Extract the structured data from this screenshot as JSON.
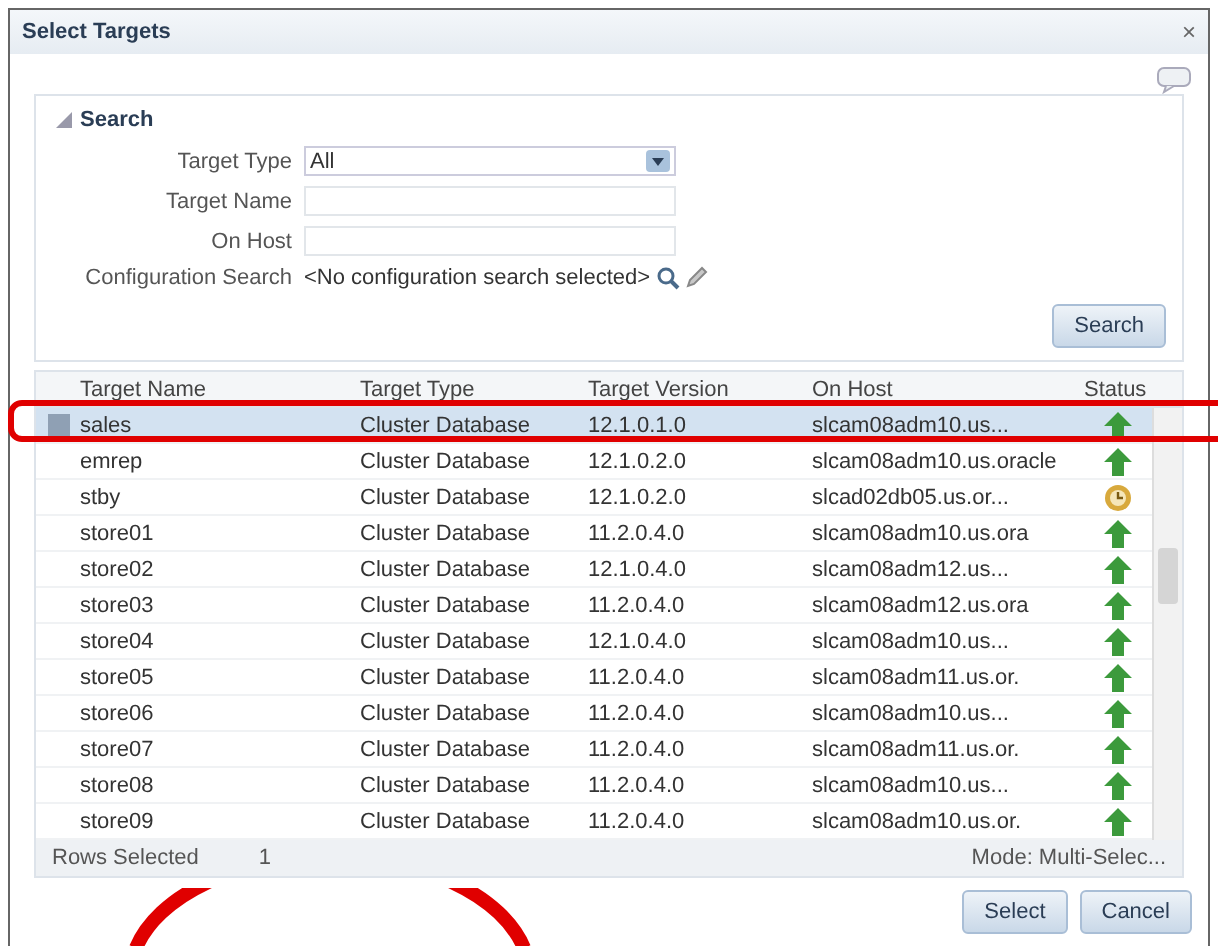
{
  "dialog": {
    "title": "Select Targets",
    "close": "×"
  },
  "search": {
    "title": "Search",
    "expanded": true,
    "fields": [
      {
        "kind": "select",
        "label": "Target Type",
        "value": "All"
      },
      {
        "kind": "text",
        "label": "Target Name"
      },
      {
        "kind": "text",
        "label": "On Host"
      },
      {
        "kind": "config",
        "label": "Configuration Search",
        "value": "<No configuration search selected>"
      }
    ],
    "button": "Search"
  },
  "table": {
    "columns": [
      "Target Name",
      "Target Type",
      "Target Version",
      "On Host",
      "Status"
    ],
    "rows": [
      {
        "name": "sales",
        "type": "Cluster Database",
        "version": "12.1.0.1.0",
        "host": "slcam08adm10.us...",
        "kind": "up",
        "selected": true
      },
      {
        "name": "emrep",
        "type": "Cluster Database",
        "version": "12.1.0.2.0",
        "host": "slcam08adm10.us.oracle",
        "kind": "up",
        "selected": false
      },
      {
        "name": "stby",
        "type": "Cluster Database",
        "version": "12.1.0.2.0",
        "host": "slcad02db05.us.or...",
        "kind": "pending",
        "selected": false
      },
      {
        "name": "store01",
        "type": "Cluster Database",
        "version": "11.2.0.4.0",
        "host": "slcam08adm10.us.ora",
        "kind": "up",
        "selected": false
      },
      {
        "name": "store02",
        "type": "Cluster Database",
        "version": "12.1.0.4.0",
        "host": "slcam08adm12.us...",
        "kind": "up",
        "selected": false
      },
      {
        "name": "store03",
        "type": "Cluster Database",
        "version": "11.2.0.4.0",
        "host": "slcam08adm12.us.ora",
        "kind": "up",
        "selected": false
      },
      {
        "name": "store04",
        "type": "Cluster Database",
        "version": "12.1.0.4.0",
        "host": "slcam08adm10.us...",
        "kind": "up",
        "selected": false
      },
      {
        "name": "store05",
        "type": "Cluster Database",
        "version": "11.2.0.4.0",
        "host": "slcam08adm11.us.or.",
        "kind": "up",
        "selected": false
      },
      {
        "name": "store06",
        "type": "Cluster Database",
        "version": "11.2.0.4.0",
        "host": "slcam08adm10.us...",
        "kind": "up",
        "selected": false
      },
      {
        "name": "store07",
        "type": "Cluster Database",
        "version": "11.2.0.4.0",
        "host": "slcam08adm11.us.or.",
        "kind": "up",
        "selected": false
      },
      {
        "name": "store08",
        "type": "Cluster Database",
        "version": "11.2.0.4.0",
        "host": "slcam08adm10.us...",
        "kind": "up",
        "selected": false
      },
      {
        "name": "store09",
        "type": "Cluster Database",
        "version": "11.2.0.4.0",
        "host": "slcam08adm10.us.or.",
        "kind": "up",
        "selected": false
      }
    ],
    "footer": {
      "label": "Rows Selected",
      "count": "1",
      "mode": "Mode: Multi-Selec..."
    }
  },
  "buttons": [
    "Select",
    "Cancel"
  ]
}
